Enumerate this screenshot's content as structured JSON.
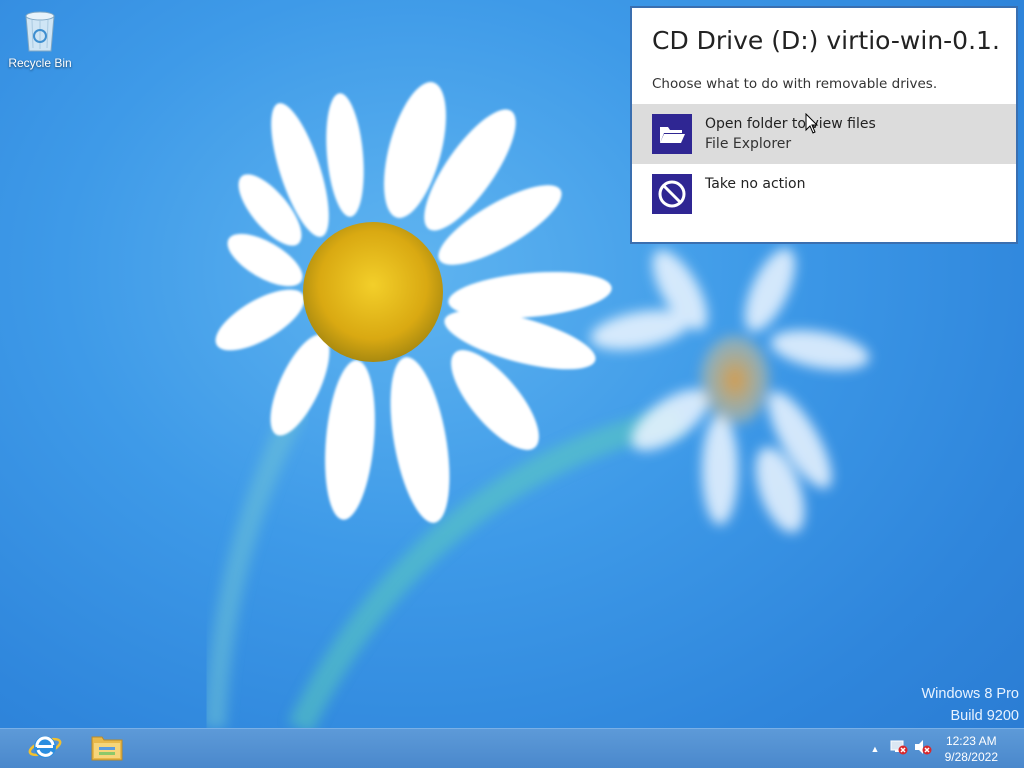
{
  "desktop": {
    "recycle_bin_label": "Recycle Bin"
  },
  "autoplay": {
    "title": "CD Drive (D:) virtio-win-0.1....",
    "subtitle": "Choose what to do with removable drives.",
    "options": [
      {
        "line1": "Open folder to view files",
        "line2": "File Explorer",
        "icon": "folder-open-icon",
        "selected": true
      },
      {
        "line1": "Take no action",
        "line2": "",
        "icon": "no-action-icon",
        "selected": false
      }
    ]
  },
  "watermark": {
    "line1": "Windows 8 Pro",
    "line2": "Build 9200"
  },
  "taskbar": {
    "pinned": [
      {
        "name": "internet-explorer-icon"
      },
      {
        "name": "file-explorer-icon"
      }
    ],
    "tray_icons": [
      "show-hidden-icons-chevron",
      "network-error-icon",
      "volume-muted-icon"
    ],
    "time": "12:23 AM",
    "date": "9/28/2022"
  },
  "colors": {
    "accent_tile": "#2f2693",
    "popup_border": "#3a6fb0",
    "selected_row": "#dcdcdc",
    "desktop_blue": "#3e9ae8"
  }
}
